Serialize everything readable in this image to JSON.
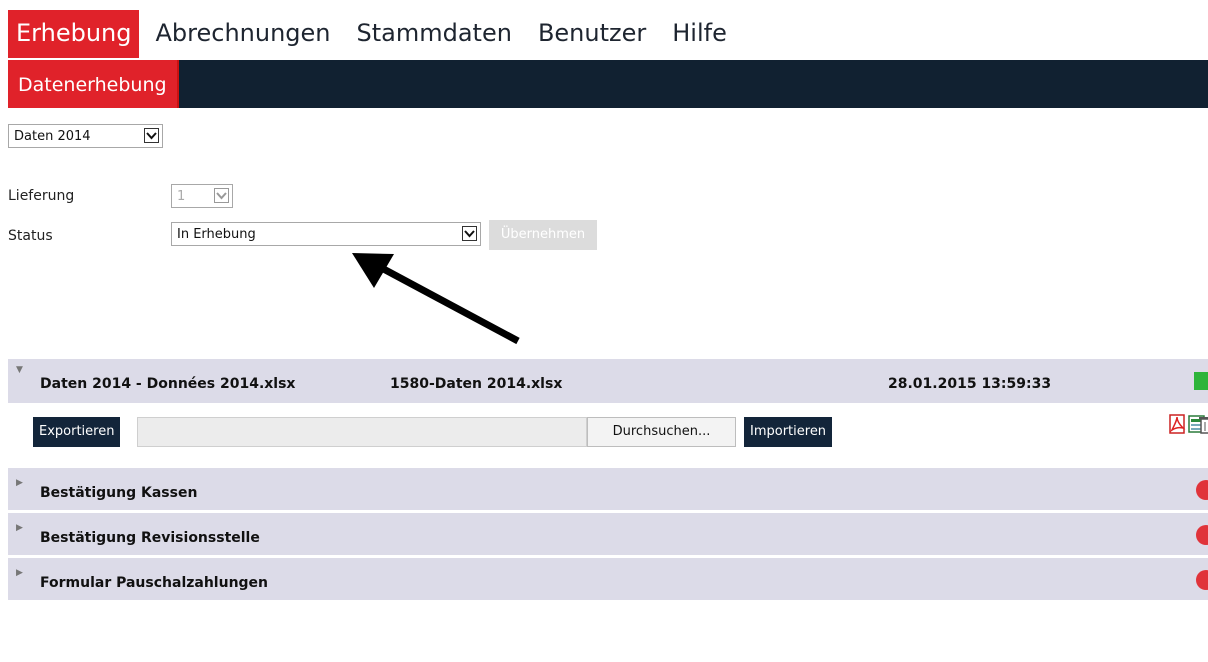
{
  "nav": {
    "top": [
      "Erhebung",
      "Abrechnungen",
      "Stammdaten",
      "Benutzer",
      "Hilfe"
    ],
    "active": "Erhebung",
    "sub": "Datenerhebung"
  },
  "year_select": {
    "value": "Daten 2014"
  },
  "form": {
    "lieferung_label": "Lieferung",
    "lieferung_value": "1",
    "status_label": "Status",
    "status_value": "In Erhebung",
    "apply_label": "Übernehmen"
  },
  "file_section": {
    "title": "Daten 2014 - Données 2014.xlsx",
    "filename": "1580-Daten 2014.xlsx",
    "timestamp": "28.01.2015 13:59:33",
    "status_color": "#2db43a",
    "export_label": "Exportieren",
    "browse_label": "Durchsuchen...",
    "import_label": "Importieren"
  },
  "sections": [
    {
      "title": "Bestätigung Kassen",
      "status_color": "#e0333a"
    },
    {
      "title": "Bestätigung Revisionsstelle",
      "status_color": "#e0333a"
    },
    {
      "title": "Formular Pauschalzahlungen",
      "status_color": "#e0333a"
    }
  ],
  "icons": [
    "pdf-icon",
    "excel-icon",
    "trash-icon"
  ],
  "colors": {
    "accent": "#e0222a",
    "dark": "#112131",
    "section_bg": "#dcdbe8"
  }
}
